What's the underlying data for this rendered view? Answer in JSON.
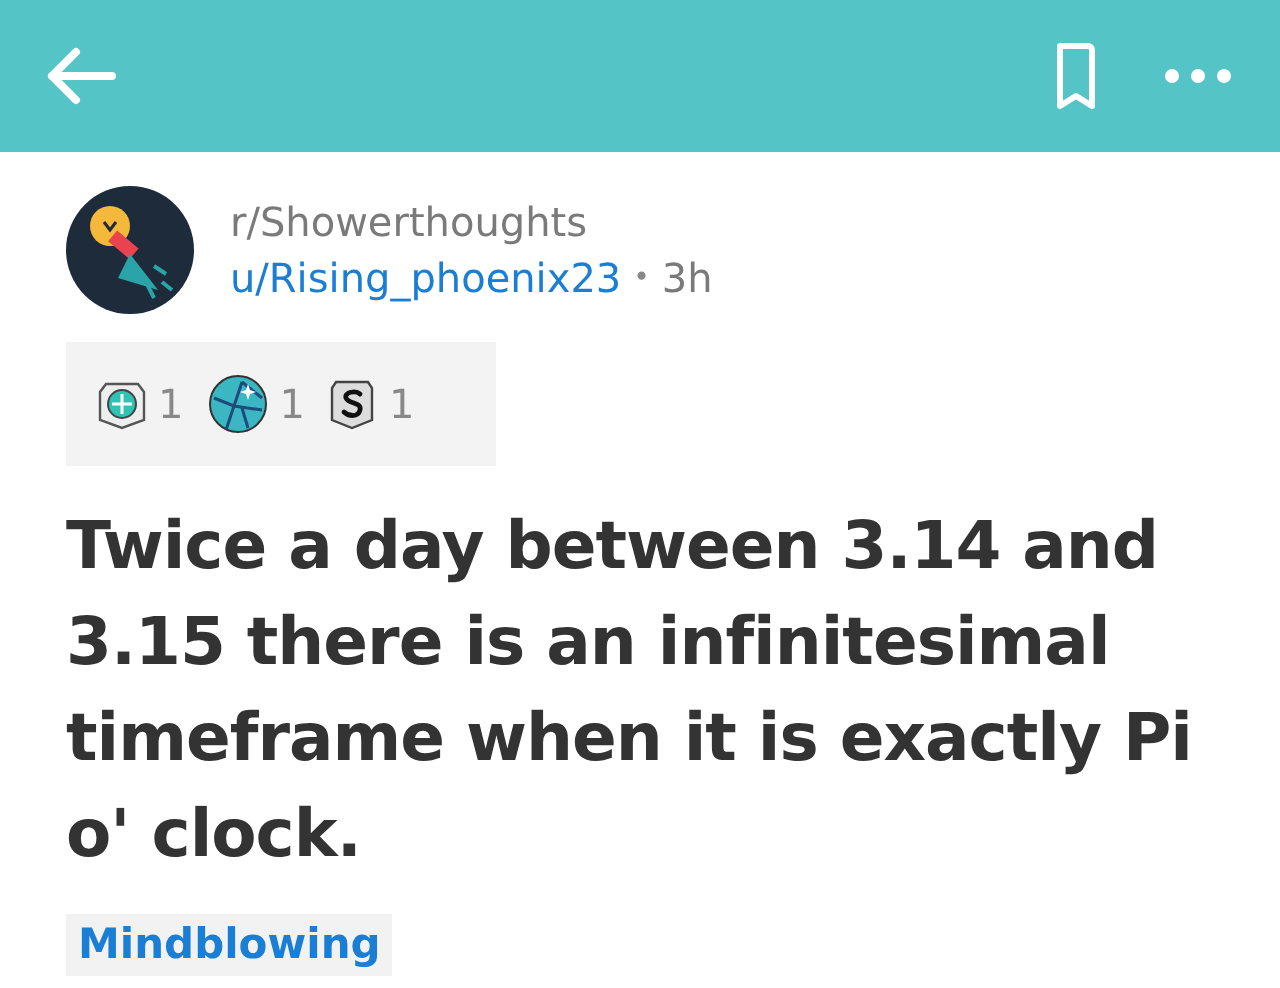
{
  "post": {
    "subreddit": "r/Showerthoughts",
    "author": "u/Rising_phoenix23",
    "separator": "•",
    "age": "3h",
    "awards": [
      {
        "kind": "gem",
        "count": "1"
      },
      {
        "kind": "globe",
        "count": "1"
      },
      {
        "kind": "silver",
        "count": "1"
      }
    ],
    "title": "Twice a day between 3.14 and 3.15 there is an infinitesimal timeframe when it is exactly Pi o' clock.",
    "flair": "Mindblowing"
  }
}
